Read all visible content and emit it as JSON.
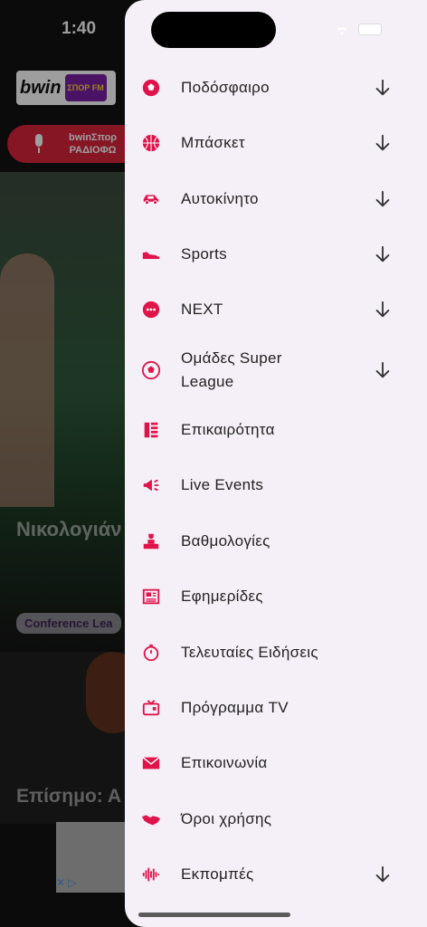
{
  "status_bar": {
    "time": "1:40"
  },
  "background": {
    "logo": {
      "brand": "bwin",
      "station": "ΣΠΟΡ FM"
    },
    "radio_pill": {
      "line1": "bwinΣπορ",
      "line2": "ΡΑΔΙΟΦΩ"
    },
    "hero": {
      "title": "Νικολογιάν μεγάλη η π Σοφή η κίνη",
      "tag": "Conference Lea"
    },
    "second_card": {
      "title": "Επίσημο: Α"
    }
  },
  "drawer": {
    "accent_color": "#e0134a",
    "items": [
      {
        "label": "Ποδόσφαιρο",
        "icon": "soccer-ball-icon",
        "expandable": true
      },
      {
        "label": "Μπάσκετ",
        "icon": "basketball-icon",
        "expandable": true
      },
      {
        "label": "Αυτοκίνητο",
        "icon": "car-icon",
        "expandable": true
      },
      {
        "label": "Sports",
        "icon": "sneaker-icon",
        "expandable": true
      },
      {
        "label": "NEXT",
        "icon": "dots-circle-icon",
        "expandable": true
      },
      {
        "label": "Ομάδες Super League",
        "icon": "team-ball-icon",
        "expandable": true
      },
      {
        "label": "Επικαιρότητα",
        "icon": "news-list-icon",
        "expandable": false
      },
      {
        "label": "Live Events",
        "icon": "megaphone-icon",
        "expandable": false
      },
      {
        "label": "Βαθμολογίες",
        "icon": "podium-icon",
        "expandable": false
      },
      {
        "label": "Εφημερίδες",
        "icon": "newspaper-icon",
        "expandable": false
      },
      {
        "label": "Τελευταίες Ειδήσεις",
        "icon": "stopwatch-icon",
        "expandable": false
      },
      {
        "label": "Πρόγραμμα TV",
        "icon": "tv-icon",
        "expandable": false
      },
      {
        "label": "Επικοινωνία",
        "icon": "envelope-icon",
        "expandable": false
      },
      {
        "label": "Όροι χρήσης",
        "icon": "handshake-icon",
        "expandable": false
      },
      {
        "label": "Εκπομπές",
        "icon": "audio-wave-icon",
        "expandable": true
      }
    ]
  }
}
